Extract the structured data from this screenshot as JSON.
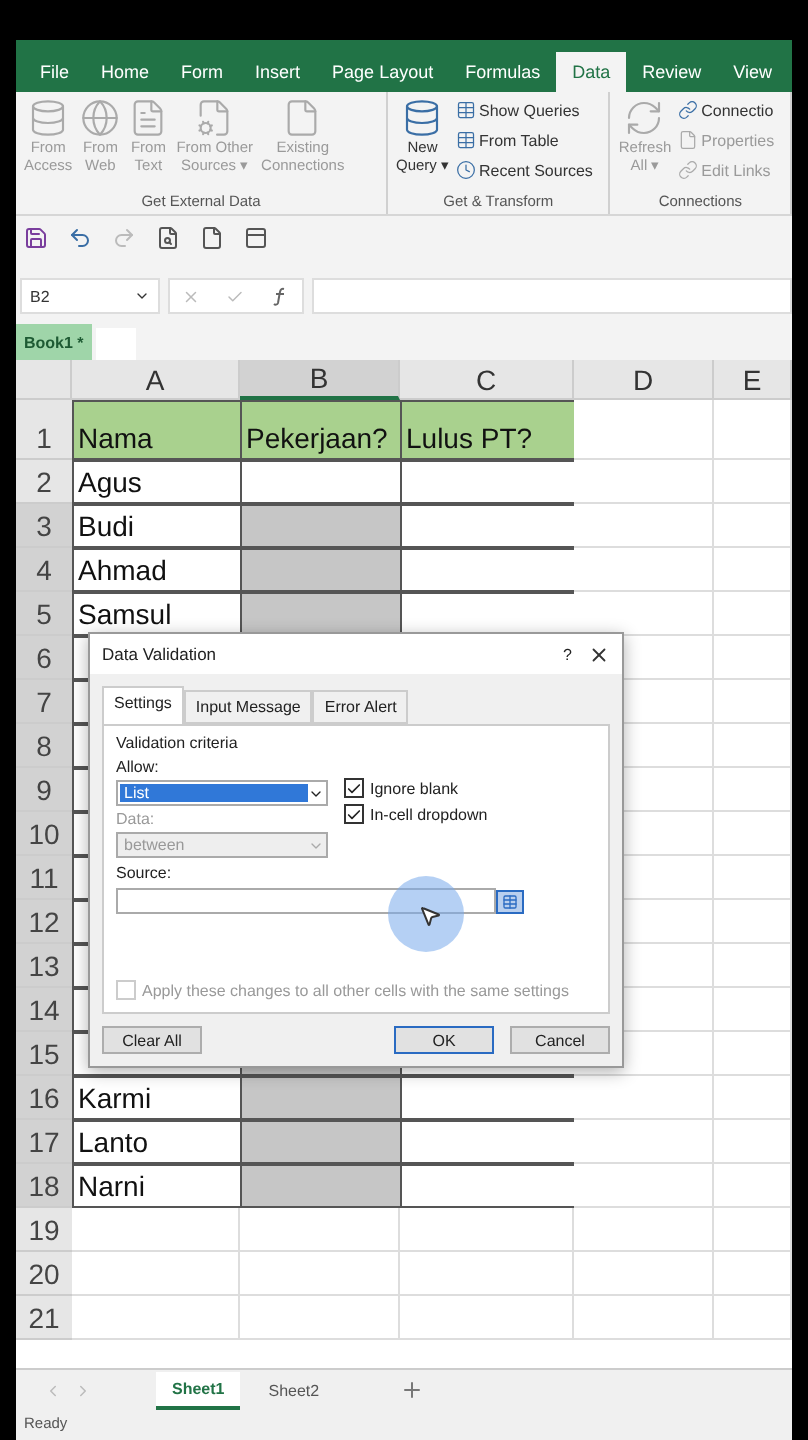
{
  "ribbon_tabs": [
    {
      "label": "File",
      "selected": false
    },
    {
      "label": "Home",
      "selected": false
    },
    {
      "label": "Form",
      "selected": false
    },
    {
      "label": "Insert",
      "selected": false
    },
    {
      "label": "Page Layout",
      "selected": false
    },
    {
      "label": "Formulas",
      "selected": false
    },
    {
      "label": "Data",
      "selected": true
    },
    {
      "label": "Review",
      "selected": false
    },
    {
      "label": "View",
      "selected": false
    }
  ],
  "ribbon_groups": [
    {
      "label": "Get External Data",
      "items": [
        {
          "kind": "large",
          "lines": [
            "From",
            "Access"
          ],
          "disabled": true
        },
        {
          "kind": "large",
          "lines": [
            "From",
            "Web"
          ],
          "disabled": true
        },
        {
          "kind": "large",
          "lines": [
            "From",
            "Text"
          ],
          "disabled": true
        },
        {
          "kind": "large",
          "lines": [
            "From Other",
            "Sources ▾"
          ],
          "disabled": true
        },
        {
          "kind": "large",
          "lines": [
            "Existing",
            "Connections"
          ],
          "disabled": true
        }
      ]
    },
    {
      "label": "Get & Transform",
      "items": [
        {
          "kind": "large",
          "lines": [
            "New",
            "Query ▾"
          ],
          "disabled": false
        },
        {
          "kind": "small",
          "lines": [
            "Show Queries"
          ],
          "disabled": false
        },
        {
          "kind": "small",
          "lines": [
            "From Table"
          ],
          "disabled": false
        },
        {
          "kind": "small",
          "lines": [
            "Recent Sources"
          ],
          "disabled": false
        }
      ]
    },
    {
      "label": "Connections",
      "items": [
        {
          "kind": "large",
          "lines": [
            "Refresh",
            "All ▾"
          ],
          "disabled": true
        },
        {
          "kind": "small",
          "lines": [
            "Connectio"
          ],
          "disabled": false
        },
        {
          "kind": "small",
          "lines": [
            "Properties"
          ],
          "disabled": true
        },
        {
          "kind": "small",
          "lines": [
            "Edit Links"
          ],
          "disabled": true
        }
      ]
    }
  ],
  "name_box": "B2",
  "workbook_tab": "Book1 *",
  "columns": [
    {
      "label": "A",
      "selected": false
    },
    {
      "label": "B",
      "selected": true
    },
    {
      "label": "C",
      "selected": false
    },
    {
      "label": "D",
      "selected": false
    },
    {
      "label": "E",
      "selected": false
    }
  ],
  "rows": [
    {
      "number": "1",
      "kind": "header",
      "selected": false,
      "cells": [
        "Nama",
        "Pekerjaan?",
        "Lulus PT?"
      ]
    },
    {
      "number": "2",
      "kind": "data",
      "selected": false,
      "cells": [
        "Agus"
      ]
    },
    {
      "number": "3",
      "kind": "data",
      "selected": true,
      "cells": [
        "Budi"
      ]
    },
    {
      "number": "4",
      "kind": "data",
      "selected": true,
      "cells": [
        "Ahmad"
      ]
    },
    {
      "number": "5",
      "kind": "data",
      "selected": true,
      "cells": [
        "Samsul"
      ]
    },
    {
      "number": "6",
      "kind": "data",
      "selected": true,
      "cells": []
    },
    {
      "number": "7",
      "kind": "data",
      "selected": true,
      "cells": []
    },
    {
      "number": "8",
      "kind": "data",
      "selected": true,
      "cells": []
    },
    {
      "number": "9",
      "kind": "data",
      "selected": true,
      "cells": []
    },
    {
      "number": "10",
      "kind": "data",
      "selected": true,
      "cells": []
    },
    {
      "number": "11",
      "kind": "data",
      "selected": true,
      "cells": []
    },
    {
      "number": "12",
      "kind": "data",
      "selected": true,
      "cells": []
    },
    {
      "number": "13",
      "kind": "data",
      "selected": true,
      "cells": []
    },
    {
      "number": "14",
      "kind": "data",
      "selected": true,
      "cells": []
    },
    {
      "number": "15",
      "kind": "data",
      "selected": true,
      "cells": []
    },
    {
      "number": "16",
      "kind": "data",
      "selected": true,
      "cells": [
        "Karmi"
      ]
    },
    {
      "number": "17",
      "kind": "data",
      "selected": true,
      "cells": [
        "Lanto"
      ]
    },
    {
      "number": "18",
      "kind": "data",
      "selected": true,
      "cells": [
        "Narni"
      ]
    },
    {
      "number": "19",
      "kind": "empty",
      "selected": false,
      "cells": []
    },
    {
      "number": "20",
      "kind": "empty",
      "selected": false,
      "cells": []
    },
    {
      "number": "21",
      "kind": "empty",
      "selected": false,
      "cells": []
    }
  ],
  "dialog": {
    "title": "Data Validation",
    "help": "?",
    "tabs": [
      {
        "label": "Settings",
        "selected": true
      },
      {
        "label": "Input Message",
        "selected": false
      },
      {
        "label": "Error Alert",
        "selected": false
      }
    ],
    "section": "Validation criteria",
    "allow": {
      "label": "Allow:",
      "value": "List"
    },
    "checkboxes": [
      {
        "label": "Ignore blank",
        "checked": true
      },
      {
        "label": "In-cell dropdown",
        "checked": true
      }
    ],
    "data": {
      "label": "Data:",
      "value": "between",
      "disabled": true
    },
    "source": {
      "label": "Source:"
    },
    "apply": {
      "label": "Apply these changes to all other cells with the same settings",
      "checked": false,
      "disabled": true
    },
    "buttons": [
      {
        "label": "Clear All",
        "kind": "left"
      },
      {
        "label": "OK",
        "kind": "default"
      },
      {
        "label": "Cancel",
        "kind": "normal"
      }
    ]
  },
  "sheets": [
    {
      "label": "Sheet1",
      "selected": true
    },
    {
      "label": "Sheet2",
      "selected": false
    }
  ],
  "status": "Ready"
}
